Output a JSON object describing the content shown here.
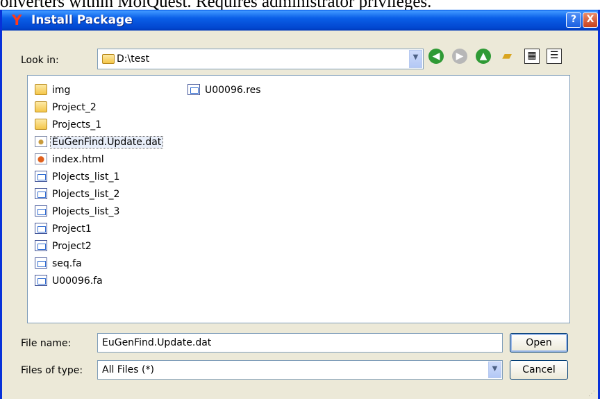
{
  "background_text": "onverters within MolQuest. Requires administrator privileges.",
  "window": {
    "title": "Install Package",
    "help_glyph": "?",
    "close_glyph": "X"
  },
  "lookin": {
    "label": "Look in:",
    "value": "D:\\test"
  },
  "toolbar": {
    "icons": [
      "back-icon",
      "forward-icon",
      "up-folder-icon",
      "new-folder-icon",
      "list-view-icon",
      "details-view-icon"
    ]
  },
  "files": [
    {
      "name": "img",
      "type": "folder"
    },
    {
      "name": "Project_2",
      "type": "folder"
    },
    {
      "name": "Projects_1",
      "type": "folder"
    },
    {
      "name": "EuGenFind.Update.dat",
      "type": "dat",
      "selected": true
    },
    {
      "name": "index.html",
      "type": "html"
    },
    {
      "name": "Plojects_list_1",
      "type": "doc"
    },
    {
      "name": "Plojects_list_2",
      "type": "doc"
    },
    {
      "name": "Plojects_list_3",
      "type": "doc"
    },
    {
      "name": "Project1",
      "type": "doc"
    },
    {
      "name": "Project2",
      "type": "doc"
    },
    {
      "name": "seq.fa",
      "type": "doc"
    },
    {
      "name": "U00096.fa",
      "type": "doc"
    },
    {
      "name": "U00096.res",
      "type": "doc"
    }
  ],
  "filename": {
    "label": "File name:",
    "value": "EuGenFind.Update.dat"
  },
  "filetype": {
    "label": "Files of type:",
    "value": "All Files (*)"
  },
  "buttons": {
    "open": "Open",
    "cancel": "Cancel"
  }
}
